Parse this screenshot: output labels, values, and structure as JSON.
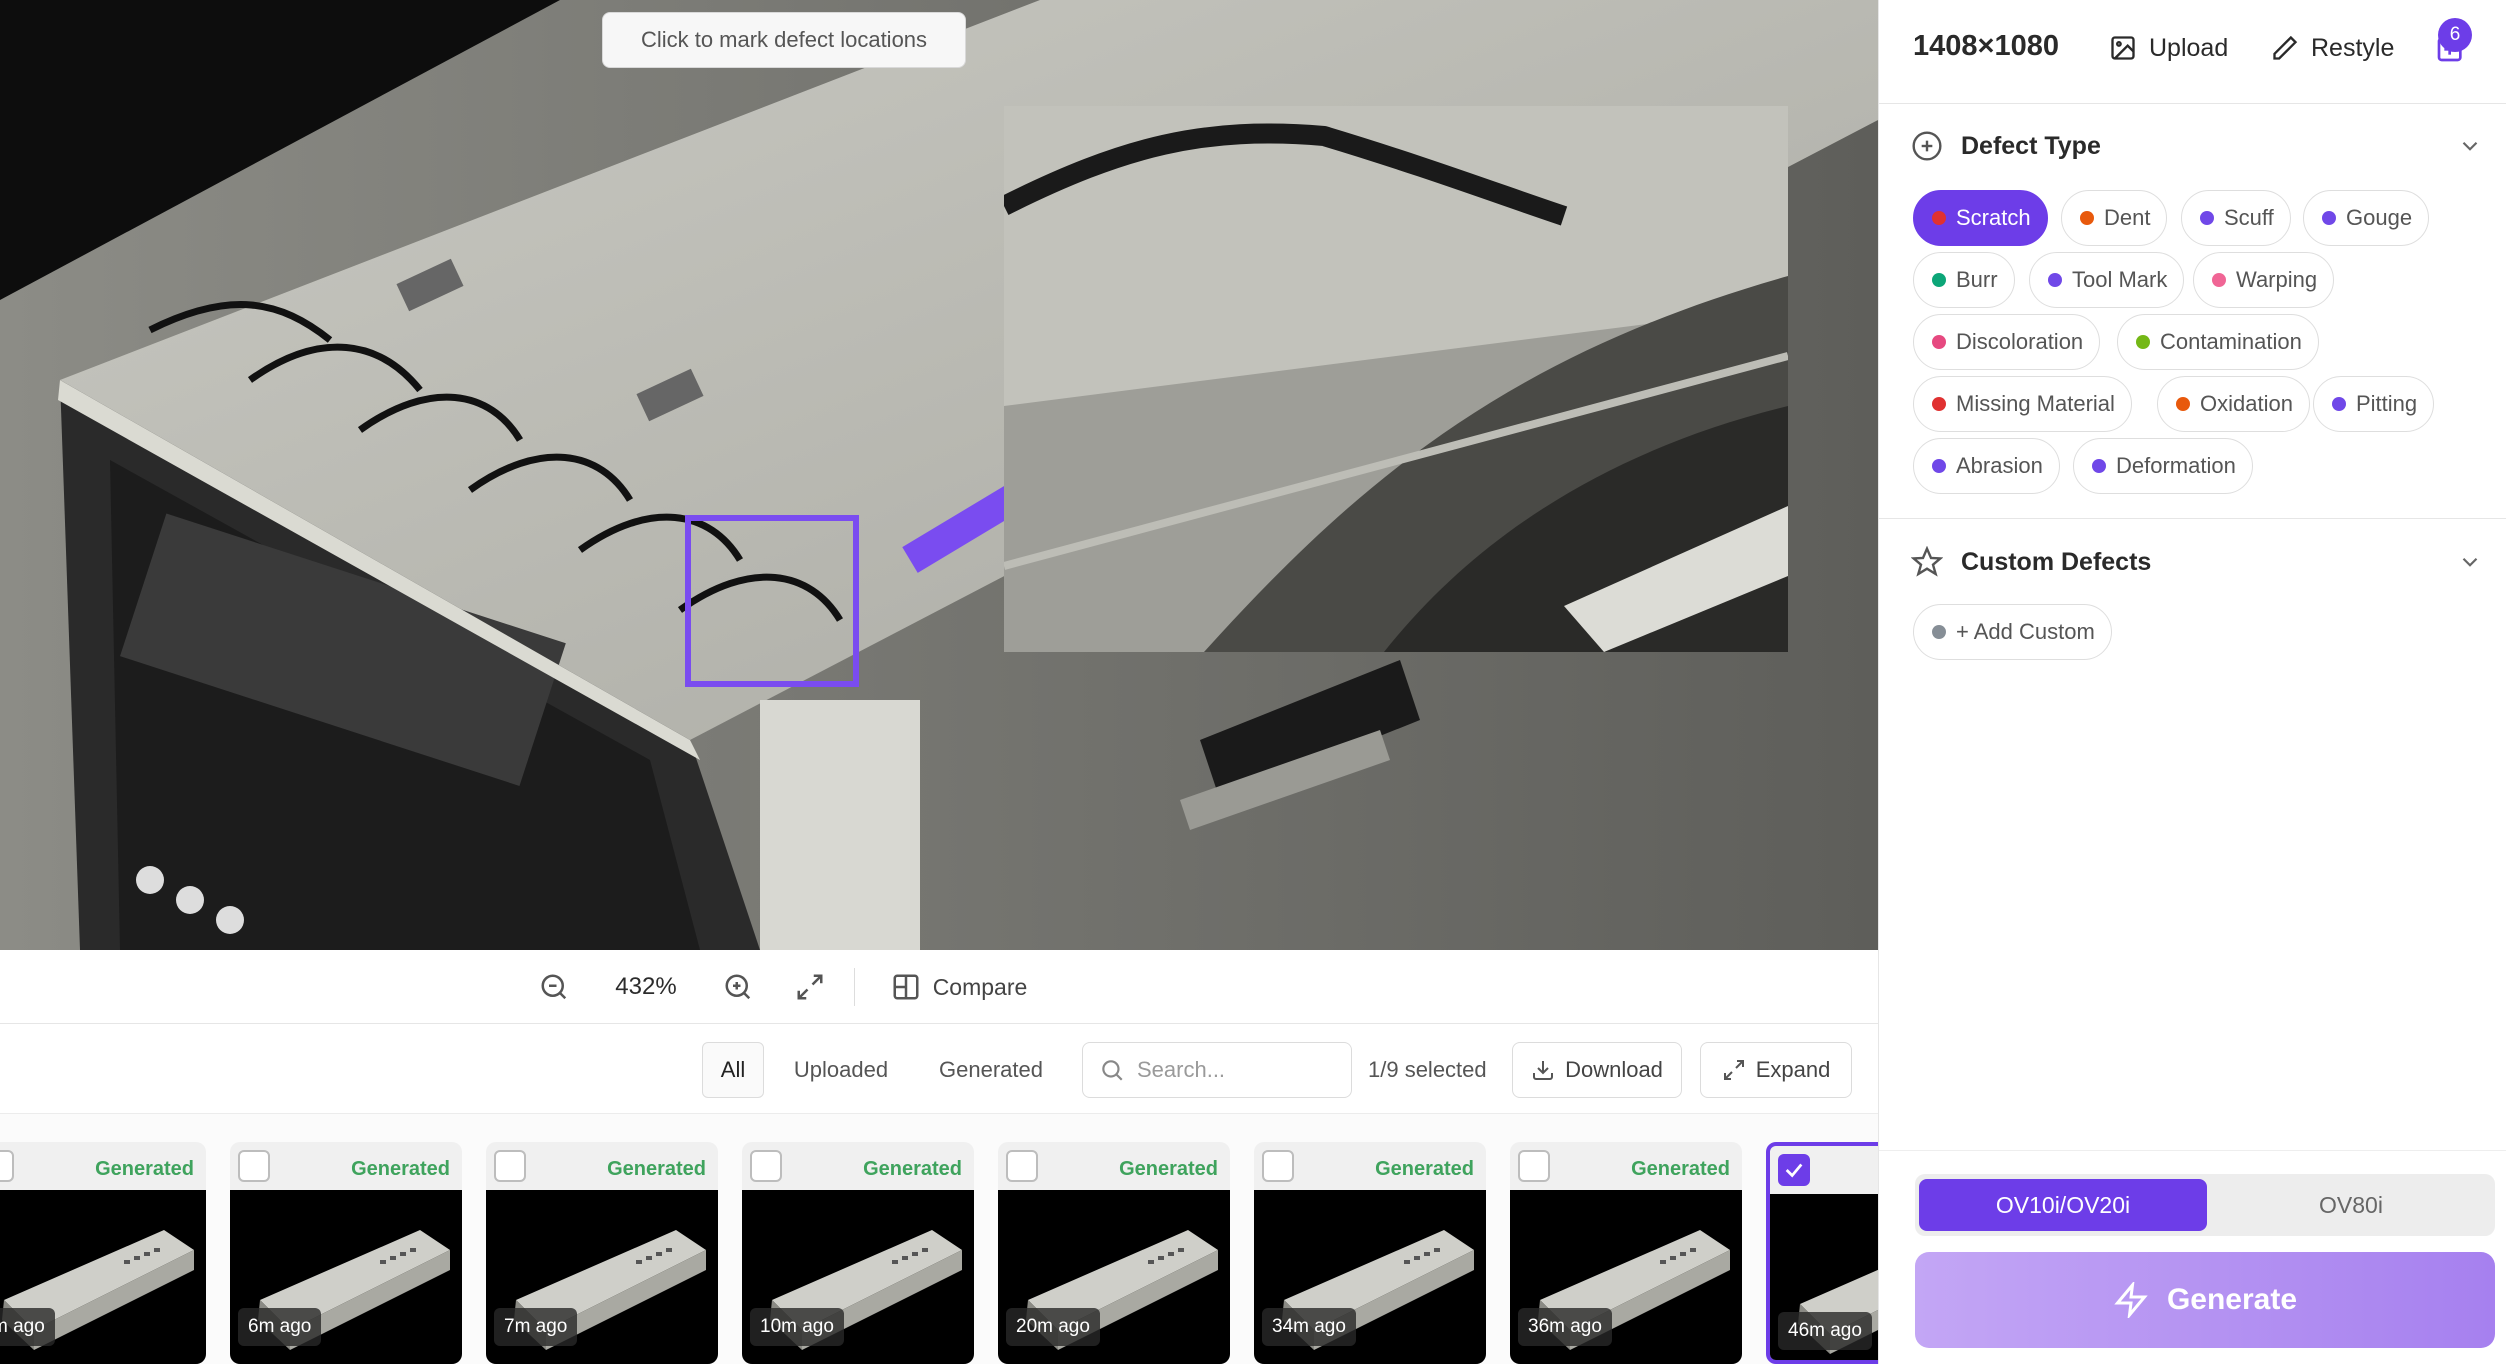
{
  "canvas": {
    "hint": "Click to mark defect locations"
  },
  "zoom_toolbar": {
    "zoom_level": "432%",
    "compare_label": "Compare"
  },
  "gallery": {
    "filters": [
      "All",
      "Uploaded",
      "Generated"
    ],
    "active_filter": "All",
    "search_placeholder": "Search...",
    "selected_count": "1/9 selected",
    "download_label": "Download",
    "expand_label": "Expand",
    "thumbnails": [
      {
        "tag": "Generated",
        "time": "m ago",
        "selected": false
      },
      {
        "tag": "Generated",
        "time": "6m ago",
        "selected": false
      },
      {
        "tag": "Generated",
        "time": "7m ago",
        "selected": false
      },
      {
        "tag": "Generated",
        "time": "10m ago",
        "selected": false
      },
      {
        "tag": "Generated",
        "time": "20m ago",
        "selected": false
      },
      {
        "tag": "Generated",
        "time": "34m ago",
        "selected": false
      },
      {
        "tag": "Generated",
        "time": "36m ago",
        "selected": false
      },
      {
        "tag": "",
        "time": "46m ago",
        "selected": true
      }
    ]
  },
  "panel": {
    "dimensions": "1408×1080",
    "upload_label": "Upload",
    "restyle_label": "Restyle",
    "layers_count": "6",
    "defect_type_title": "Defect Type",
    "defect_types": [
      {
        "label": "Scratch",
        "color": "#e03131",
        "active": true
      },
      {
        "label": "Dent",
        "color": "#e8590c",
        "active": false
      },
      {
        "label": "Scuff",
        "color": "#7048e8",
        "active": false
      },
      {
        "label": "Gouge",
        "color": "#7048e8",
        "active": false
      },
      {
        "label": "Burr",
        "color": "#0ca678",
        "active": false
      },
      {
        "label": "Tool Mark",
        "color": "#7048e8",
        "active": false
      },
      {
        "label": "Warping",
        "color": "#f06595",
        "active": false
      },
      {
        "label": "Discoloration",
        "color": "#e64980",
        "active": false
      },
      {
        "label": "Contamination",
        "color": "#74b816",
        "active": false
      },
      {
        "label": "Missing Material",
        "color": "#e03131",
        "active": false
      },
      {
        "label": "Oxidation",
        "color": "#e8590c",
        "active": false
      },
      {
        "label": "Pitting",
        "color": "#7048e8",
        "active": false
      },
      {
        "label": "Abrasion",
        "color": "#7048e8",
        "active": false
      },
      {
        "label": "Deformation",
        "color": "#7048e8",
        "active": false
      }
    ],
    "custom_defects_title": "Custom Defects",
    "add_custom_label": "+ Add Custom",
    "add_custom_color": "#868e96",
    "models": [
      "OV10i/OV20i",
      "OV80i"
    ],
    "active_model": "OV10i/OV20i",
    "generate_label": "Generate",
    "accent_color": "#6d3de8"
  }
}
